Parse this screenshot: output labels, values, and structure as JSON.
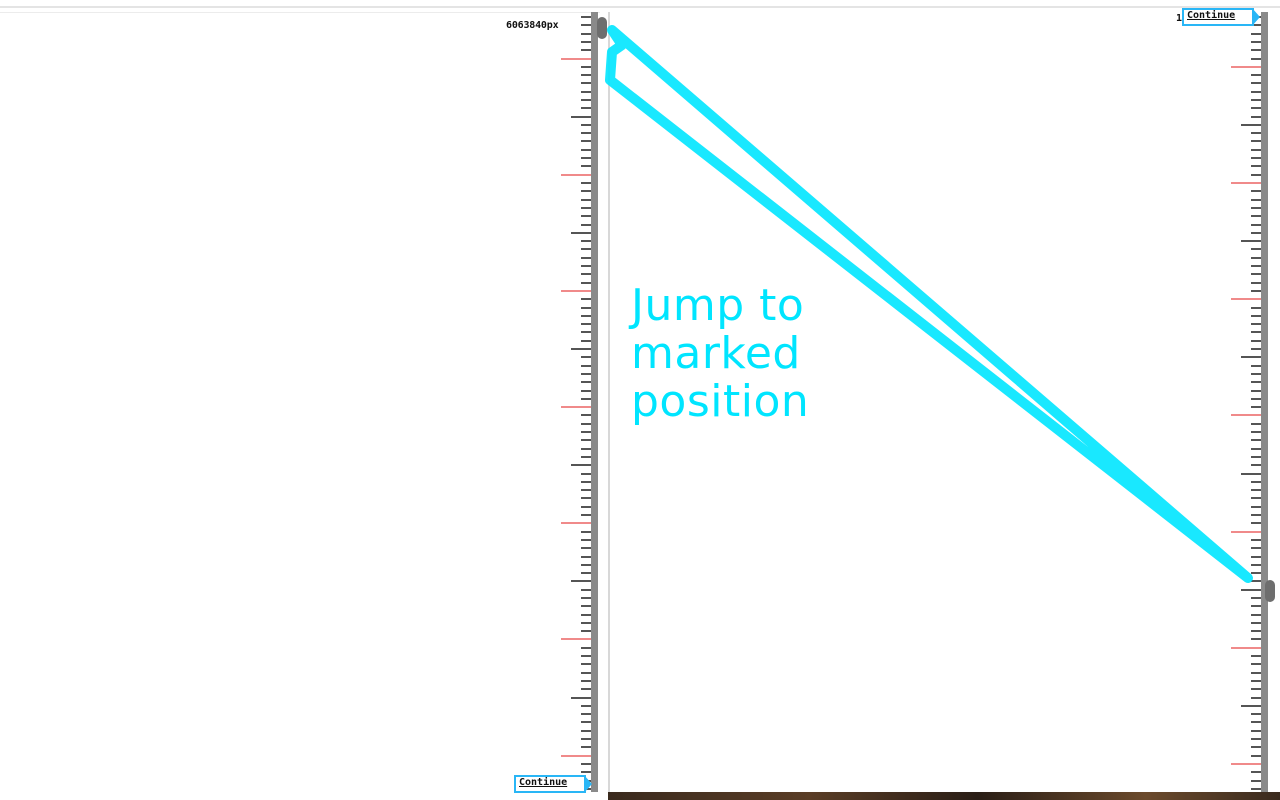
{
  "left_panel": {
    "scroll_offset_label": "6063840px",
    "continue_label": "Continue"
  },
  "right_panel": {
    "continue_label": "Continue",
    "marker_char": "1"
  },
  "annotation": {
    "text_line1": "Jump to",
    "text_line2": "marked",
    "text_line3": "position",
    "color": "#00e5ff"
  },
  "colors": {
    "major_tick": "#f08a8a",
    "minor_tick": "#555555",
    "track": "#8a8a8a",
    "thumb": "#6e6e6e",
    "button_border": "#29b6f6"
  },
  "icons": {
    "continue_arrow": "chevron-right-icon"
  }
}
